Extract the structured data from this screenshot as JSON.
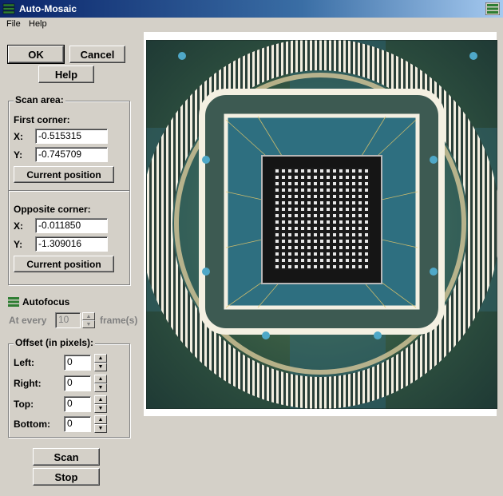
{
  "window": {
    "title": "Auto-Mosaic"
  },
  "menu": {
    "file": "File",
    "help": "Help"
  },
  "buttons": {
    "ok": "OK",
    "cancel": "Cancel",
    "help": "Help",
    "scan": "Scan",
    "stop": "Stop"
  },
  "scan_area": {
    "label": "Scan area:",
    "first_corner": {
      "label": "First corner:",
      "x_label": "X:",
      "x": "-0.515315",
      "y_label": "Y:",
      "y": "-0.745709",
      "button": "Current position"
    },
    "opposite_corner": {
      "label": "Opposite corner:",
      "x_label": "X:",
      "x": "-0.011850",
      "y_label": "Y:",
      "y": "-1.309016",
      "button": "Current position"
    }
  },
  "autofocus": {
    "label": "Autofocus",
    "at_every": "At every",
    "frames_value": "10",
    "frames_suffix": "frame(s)"
  },
  "offset": {
    "label": "Offset (in pixels):",
    "left_label": "Left:",
    "left": "0",
    "right_label": "Right:",
    "right": "0",
    "top_label": "Top:",
    "top": "0",
    "bottom_label": "Bottom:",
    "bottom": "0"
  },
  "colors": {
    "titlebar": "#0a246a",
    "panel": "#d4d0c8",
    "icon_green": "#2e7d32"
  }
}
